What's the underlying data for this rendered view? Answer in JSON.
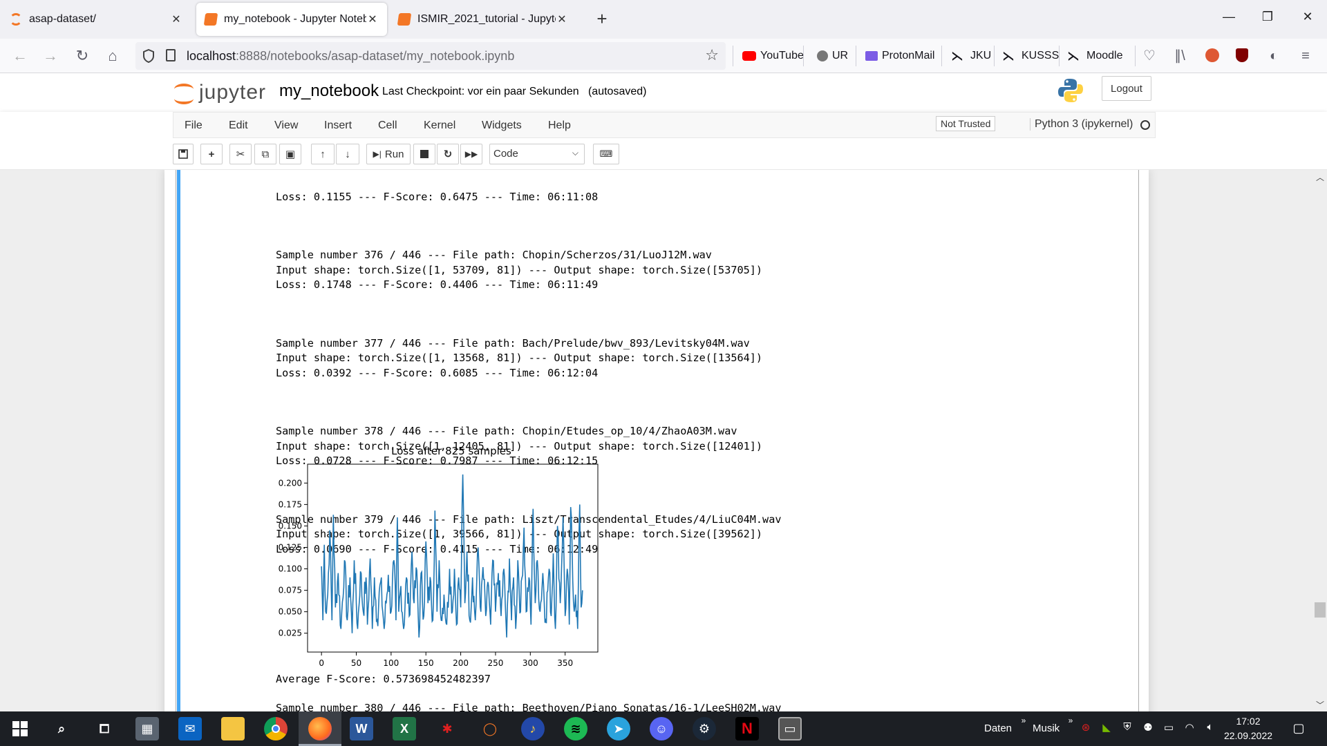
{
  "browser": {
    "tabs": [
      {
        "title": "asap-dataset/",
        "active": false
      },
      {
        "title": "my_notebook - Jupyter Notebook",
        "active": true
      },
      {
        "title": "ISMIR_2021_tutorial - Jupyter Notebook",
        "active": false
      }
    ],
    "url_host": "localhost",
    "url_rest": ":8888/notebooks/asap-dataset/my_notebook.ipynb",
    "bookmarks": [
      "YouTube",
      "UR",
      "ProtonMail",
      "JKU",
      "KUSSS",
      "Moodle"
    ]
  },
  "jupyter": {
    "logo_text": "jupyter",
    "notebook_name": "my_notebook",
    "checkpoint": "Last Checkpoint: vor ein paar Sekunden",
    "autosaved": "(autosaved)",
    "logout_label": "Logout",
    "menu": [
      "File",
      "Edit",
      "View",
      "Insert",
      "Cell",
      "Kernel",
      "Widgets",
      "Help"
    ],
    "trust_status": "Not Trusted",
    "kernel": "Python 3 (ipykernel)",
    "run_label": "Run",
    "cell_type": "Code"
  },
  "output": {
    "partial_top": "Loss: 0.1155 --- F-Score: 0.6475 --- Time: 06:11:08",
    "samples": [
      {
        "line1": "Sample number 376 / 446 --- File path: Chopin/Scherzos/31/LuoJ12M.wav",
        "line2": "Input shape: torch.Size([1, 53709, 81]) --- Output shape: torch.Size([53705])",
        "line3": "Loss: 0.1748 --- F-Score: 0.4406 --- Time: 06:11:49"
      },
      {
        "line1": "Sample number 377 / 446 --- File path: Bach/Prelude/bwv_893/Levitsky04M.wav",
        "line2": "Input shape: torch.Size([1, 13568, 81]) --- Output shape: torch.Size([13564])",
        "line3": "Loss: 0.0392 --- F-Score: 0.6085 --- Time: 06:12:04"
      },
      {
        "line1": "Sample number 378 / 446 --- File path: Chopin/Etudes_op_10/4/ZhaoA03M.wav",
        "line2": "Input shape: torch.Size([1, 12405, 81]) --- Output shape: torch.Size([12401])",
        "line3": "Loss: 0.0728 --- F-Score: 0.7987 --- Time: 06:12:15"
      },
      {
        "line1": "Sample number 379 / 446 --- File path: Liszt/Transcendental_Etudes/4/LiuC04M.wav",
        "line2": "Input shape: torch.Size([1, 39566, 81]) --- Output shape: torch.Size([39562])",
        "line3": "Loss: 0.0690 --- F-Score: 0.4115 --- Time: 06:12:49"
      }
    ],
    "average": "Average F-Score: 0.573698452482397",
    "next_partial": "Sample number 380 / 446 --- File path: Beethoven/Piano_Sonatas/16-1/LeeSH02M.wav"
  },
  "chart_data": {
    "type": "line",
    "title": "Loss after 825 samples",
    "xlabel": "",
    "ylabel": "",
    "xlim": [
      -20,
      397
    ],
    "ylim": [
      0.003,
      0.222
    ],
    "xticks": [
      0,
      50,
      100,
      150,
      200,
      250,
      300,
      350
    ],
    "yticks": [
      0.025,
      0.05,
      0.075,
      0.1,
      0.125,
      0.15,
      0.175,
      0.2
    ],
    "ytick_labels": [
      "0.025",
      "0.050",
      "0.075",
      "0.100",
      "0.125",
      "0.150",
      "0.175",
      "0.200"
    ],
    "color": "#1f77b4",
    "peaks": [
      [
        0,
        0.103
      ],
      [
        2,
        0.04
      ],
      [
        4,
        0.128
      ],
      [
        6,
        0.05
      ],
      [
        9,
        0.07
      ],
      [
        12,
        0.145
      ],
      [
        15,
        0.04
      ],
      [
        17,
        0.163
      ],
      [
        20,
        0.055
      ],
      [
        24,
        0.095
      ],
      [
        28,
        0.03
      ],
      [
        33,
        0.11
      ],
      [
        37,
        0.04
      ],
      [
        41,
        0.09
      ],
      [
        44,
        0.025
      ],
      [
        47,
        0.11
      ],
      [
        52,
        0.03
      ],
      [
        56,
        0.097
      ],
      [
        60,
        0.05
      ],
      [
        64,
        0.09
      ],
      [
        66,
        0.035
      ],
      [
        70,
        0.112
      ],
      [
        73,
        0.03
      ],
      [
        76,
        0.09
      ],
      [
        80,
        0.04
      ],
      [
        85,
        0.085
      ],
      [
        90,
        0.03
      ],
      [
        96,
        0.093
      ],
      [
        100,
        0.05
      ],
      [
        104,
        0.11
      ],
      [
        107,
        0.04
      ],
      [
        109,
        0.16
      ],
      [
        111,
        0.05
      ],
      [
        114,
        0.08
      ],
      [
        118,
        0.03
      ],
      [
        122,
        0.09
      ],
      [
        126,
        0.045
      ],
      [
        130,
        0.12
      ],
      [
        133,
        0.06
      ],
      [
        137,
        0.098
      ],
      [
        140,
        0.02
      ],
      [
        143,
        0.095
      ],
      [
        147,
        0.045
      ],
      [
        150,
        0.132
      ],
      [
        153,
        0.06
      ],
      [
        157,
        0.085
      ],
      [
        160,
        0.04
      ],
      [
        163,
        0.168
      ],
      [
        166,
        0.05
      ],
      [
        169,
        0.11
      ],
      [
        172,
        0.04
      ],
      [
        176,
        0.07
      ],
      [
        180,
        0.035
      ],
      [
        184,
        0.1
      ],
      [
        188,
        0.05
      ],
      [
        191,
        0.1
      ],
      [
        194,
        0.035
      ],
      [
        197,
        0.09
      ],
      [
        200,
        0.055
      ],
      [
        203,
        0.212
      ],
      [
        206,
        0.06
      ],
      [
        209,
        0.12
      ],
      [
        213,
        0.04
      ],
      [
        217,
        0.09
      ],
      [
        221,
        0.04
      ],
      [
        225,
        0.125
      ],
      [
        229,
        0.05
      ],
      [
        232,
        0.102
      ],
      [
        236,
        0.045
      ],
      [
        240,
        0.08
      ],
      [
        243,
        0.035
      ],
      [
        246,
        0.11
      ],
      [
        250,
        0.05
      ],
      [
        254,
        0.095
      ],
      [
        258,
        0.045
      ],
      [
        262,
        0.1
      ],
      [
        266,
        0.02
      ],
      [
        270,
        0.112
      ],
      [
        273,
        0.04
      ],
      [
        276,
        0.09
      ],
      [
        279,
        0.03
      ],
      [
        282,
        0.11
      ],
      [
        286,
        0.05
      ],
      [
        291,
        0.148
      ],
      [
        294,
        0.05
      ],
      [
        298,
        0.09
      ],
      [
        301,
        0.035
      ],
      [
        304,
        0.17
      ],
      [
        307,
        0.06
      ],
      [
        310,
        0.11
      ],
      [
        314,
        0.05
      ],
      [
        318,
        0.095
      ],
      [
        322,
        0.04
      ],
      [
        327,
        0.1
      ],
      [
        330,
        0.045
      ],
      [
        333,
        0.118
      ],
      [
        336,
        0.03
      ],
      [
        339,
        0.15
      ],
      [
        343,
        0.06
      ],
      [
        347,
        0.16
      ],
      [
        350,
        0.045
      ],
      [
        353,
        0.1
      ],
      [
        356,
        0.035
      ],
      [
        358,
        0.172
      ],
      [
        362,
        0.062
      ],
      [
        365,
        0.07
      ],
      [
        368,
        0.03
      ],
      [
        371,
        0.175
      ],
      [
        373,
        0.055
      ],
      [
        375,
        0.075
      ]
    ]
  },
  "taskbar": {
    "tray_daten": "Daten",
    "tray_musik": "Musik",
    "time": "17:02",
    "date": "22.09.2022"
  }
}
